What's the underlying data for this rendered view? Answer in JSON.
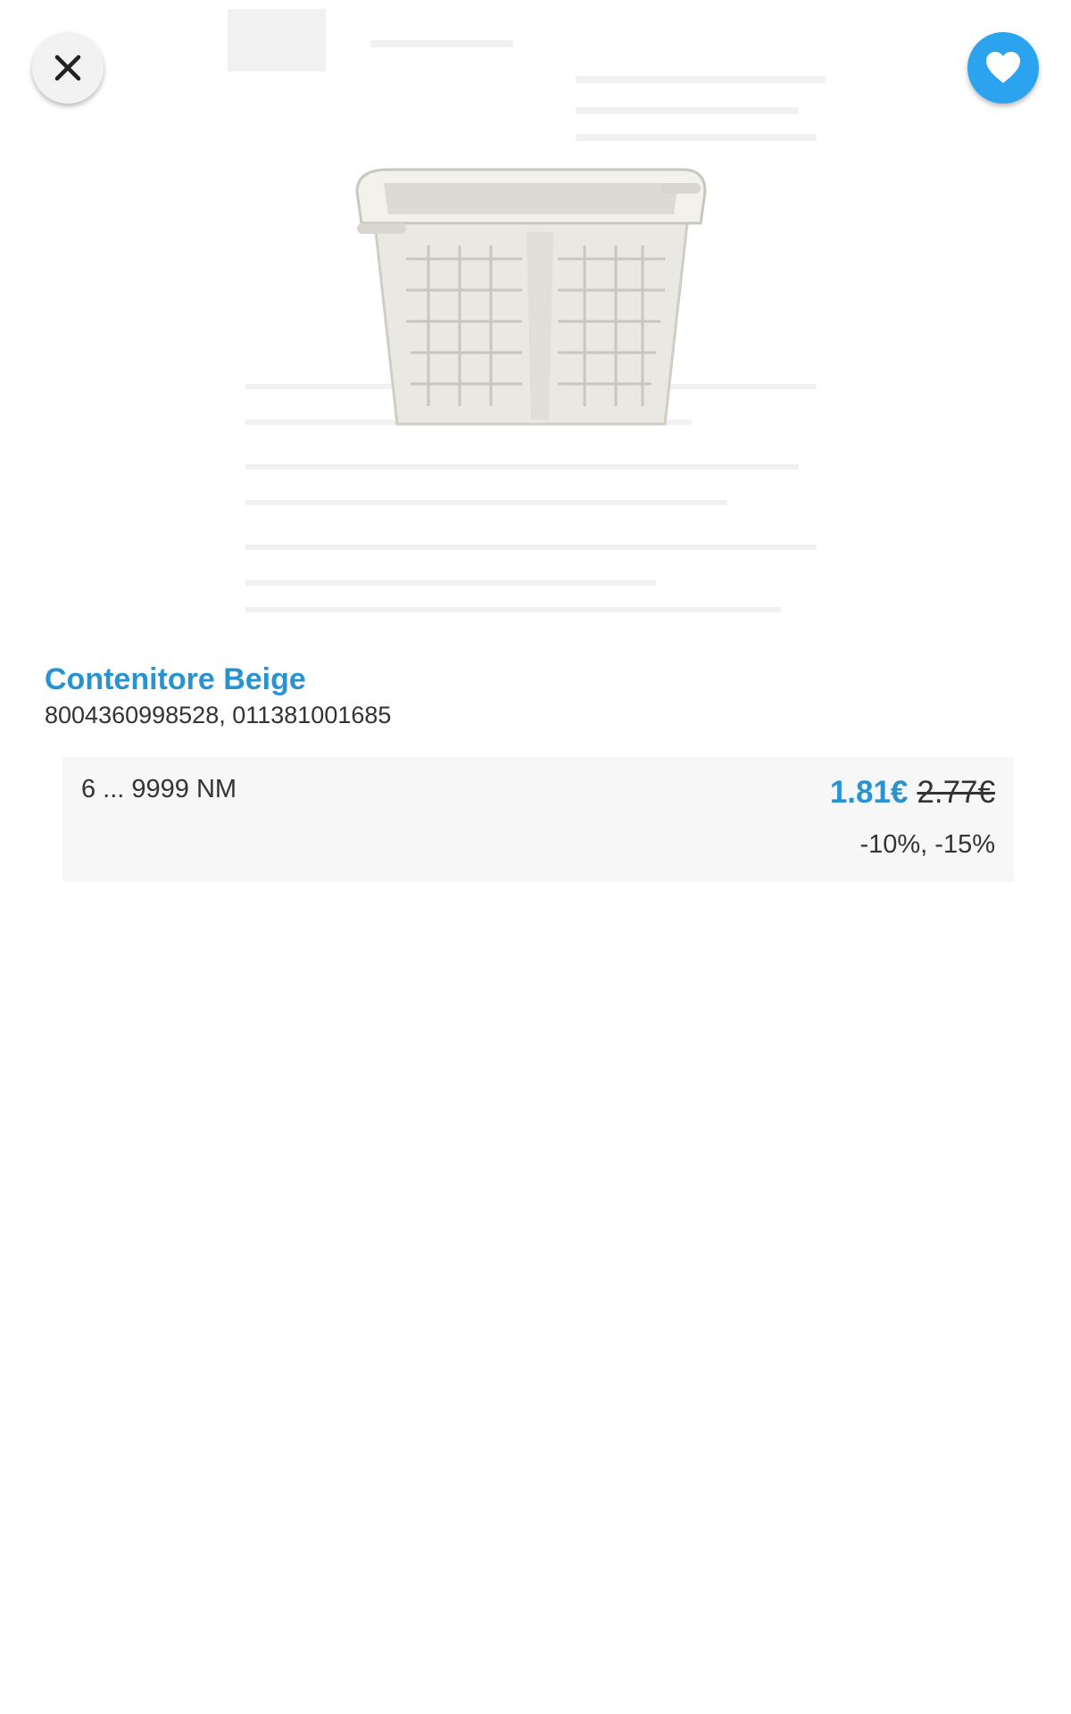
{
  "colors": {
    "accent": "#2793d1",
    "favorite_bg": "#2ba3ee"
  },
  "header": {
    "close_icon": "close-icon",
    "favorite_icon": "heart-icon"
  },
  "product": {
    "image_subject": "white woven plastic basket",
    "title": "Contenitore Beige",
    "codes": "8004360998528, 011381001685"
  },
  "pricing": {
    "quantity_range": "6 ... 9999 NM",
    "current_price": "1.81€",
    "old_price": "2.77€",
    "discounts": "-10%, -15%"
  }
}
